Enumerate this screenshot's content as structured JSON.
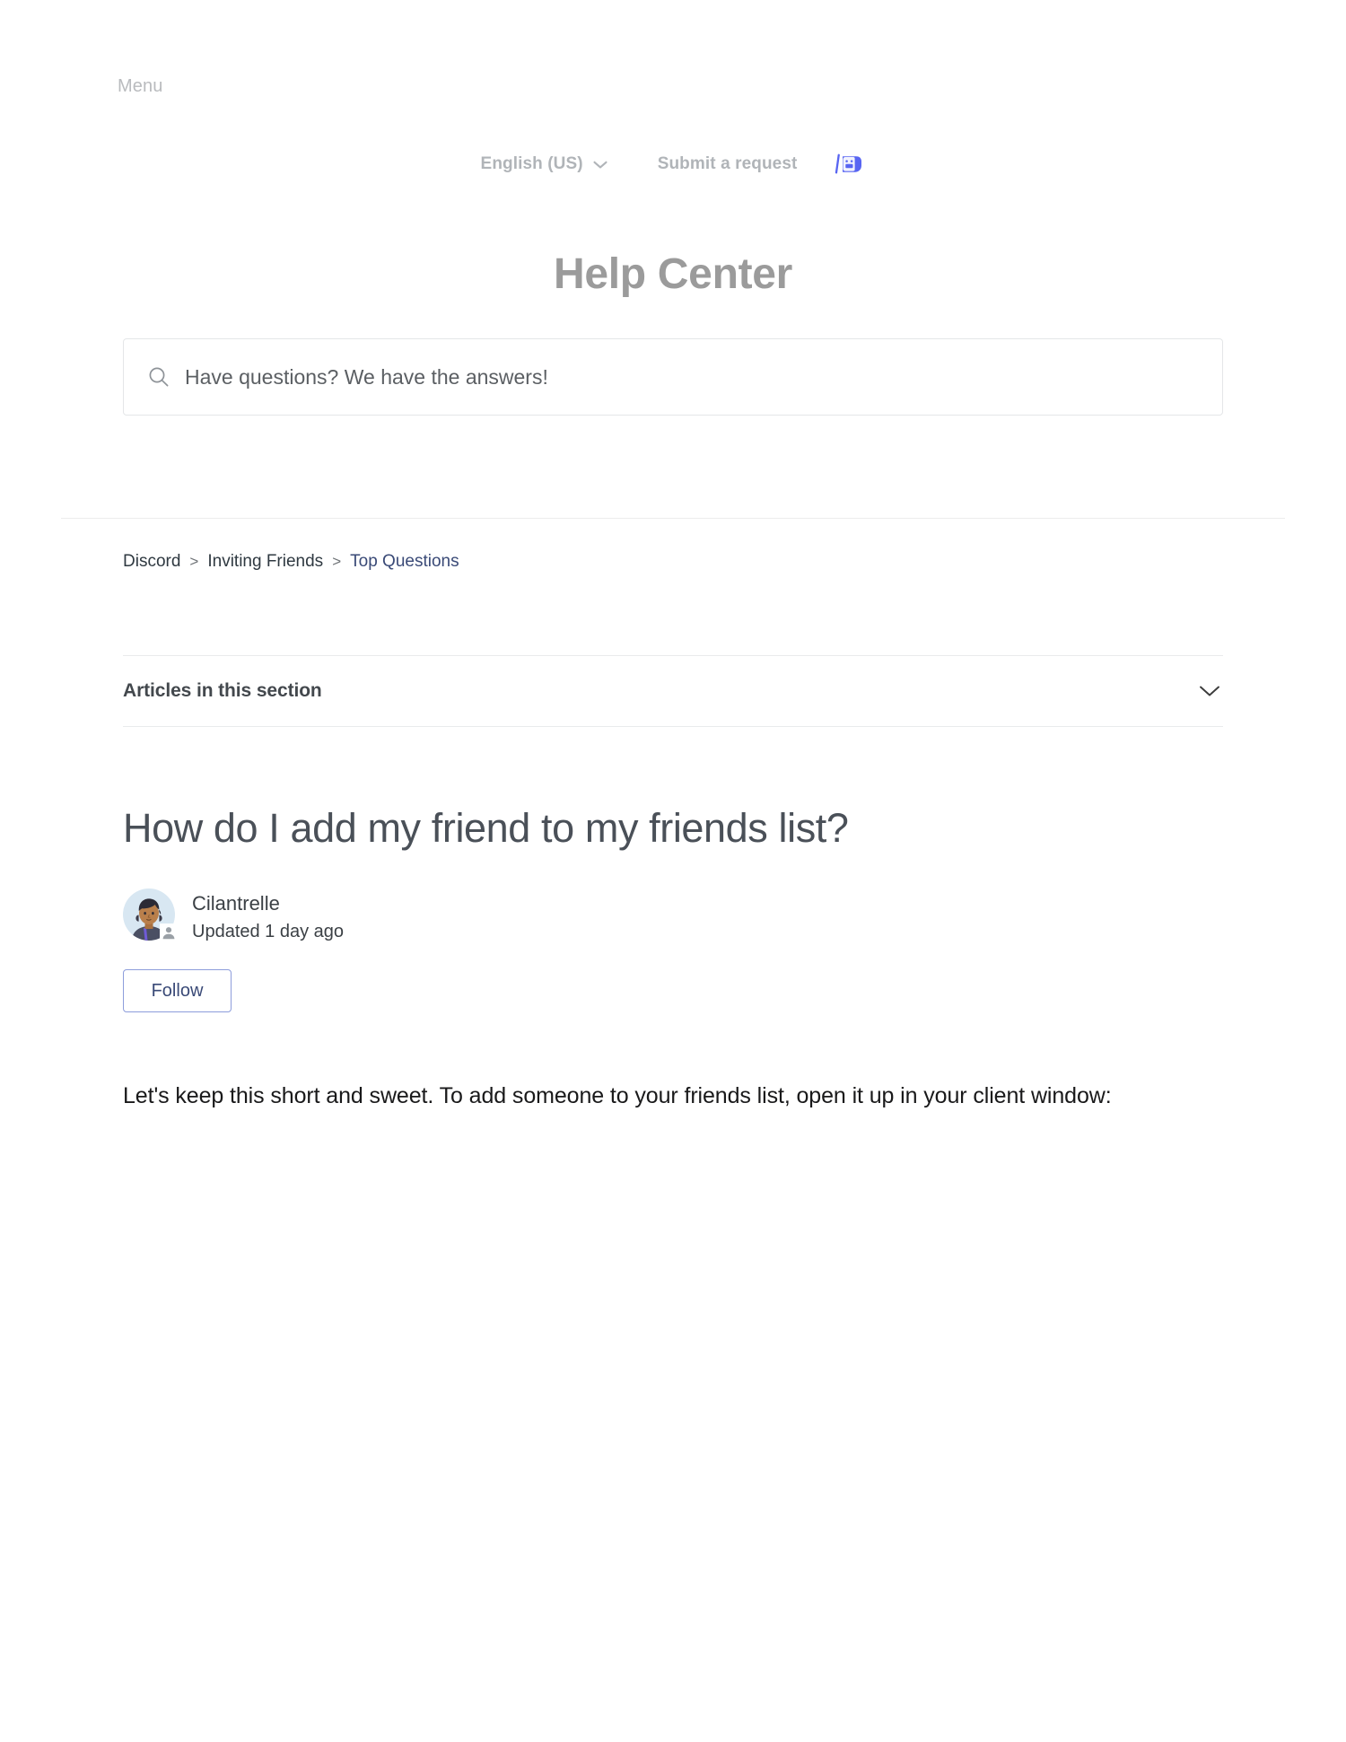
{
  "header": {
    "menu_label": "Menu",
    "language": "English (US)",
    "language_chevron_icon": "chevron-down-icon",
    "submit_request_label": "Submit a request",
    "brand_icon": "discord-wumpus-icon",
    "brand_icon_color": "#5865f2"
  },
  "hero": {
    "title": "Help Center",
    "title_color": "#9b9b9b",
    "search": {
      "icon": "search-icon",
      "placeholder": "Have questions? We have the answers!",
      "value": ""
    }
  },
  "breadcrumb": {
    "separator": ">",
    "items": [
      {
        "label": "Discord",
        "current": false
      },
      {
        "label": "Inviting Friends",
        "current": false
      },
      {
        "label": "Top Questions",
        "current": true
      }
    ],
    "current_color": "#3a4a77"
  },
  "section": {
    "title": "Articles in this section",
    "toggle_icon": "chevron-down-icon",
    "expanded": false
  },
  "article": {
    "title": "How do I add my friend to my friends list?",
    "author": {
      "name": "Cilantrelle",
      "avatar_icon": "user-avatar-illustration",
      "badge_icon": "person-badge-icon"
    },
    "updated": "Updated 1 day ago",
    "follow_label": "Follow",
    "follow_border_color": "#8d9ddb",
    "follow_text_color": "#3a4a77",
    "body": "Let's keep this short and sweet. To add someone to your friends list, open it up in your client window:"
  }
}
